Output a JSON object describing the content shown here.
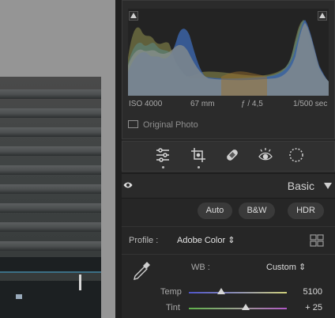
{
  "exif": {
    "iso": "ISO 4000",
    "focal": "67 mm",
    "aperture": "ƒ / 4,5",
    "shutter": "1/500 sec"
  },
  "histogram": {
    "original_photo_label": "Original Photo"
  },
  "tools": [
    {
      "name": "edit-sliders-icon",
      "active": true
    },
    {
      "name": "crop-icon",
      "active": false
    },
    {
      "name": "healing-icon",
      "active": false
    },
    {
      "name": "red-eye-icon",
      "active": false
    },
    {
      "name": "masking-icon",
      "active": false
    }
  ],
  "basic_panel": {
    "title": "Basic",
    "buttons": {
      "auto": "Auto",
      "bw": "B&W",
      "hdr": "HDR"
    },
    "profile": {
      "label": "Profile :",
      "value": "Adobe Color ⇕"
    },
    "wb": {
      "label": "WB :",
      "value": "Custom ⇕"
    },
    "temp": {
      "label": "Temp",
      "value": "5100",
      "position": 0.33
    },
    "tint": {
      "label": "Tint",
      "value": "+ 25",
      "position": 0.58
    }
  },
  "colors": {
    "panel": "#262626",
    "temp_track": "#6f6fd0",
    "tint_track": "#7fbf5f",
    "accent": "#d6d6d6"
  }
}
